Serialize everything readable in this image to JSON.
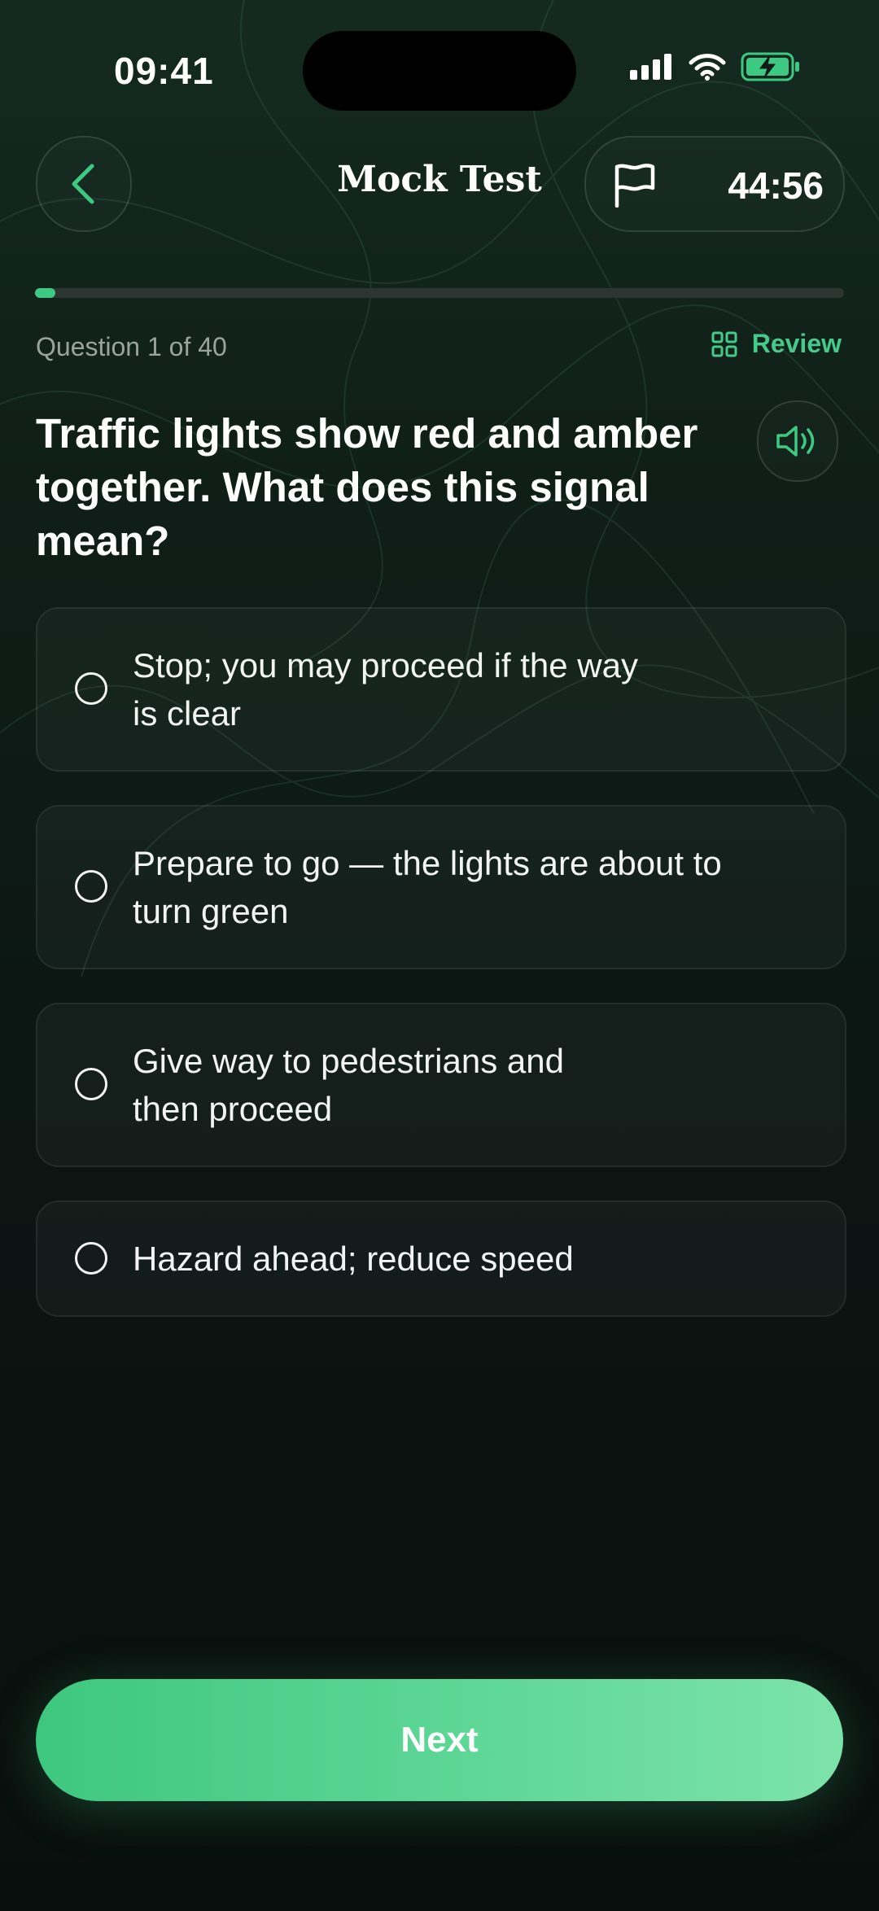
{
  "status_bar": {
    "time": "09:41"
  },
  "header": {
    "title": "Mock Test",
    "timer": "44:56"
  },
  "progress": {
    "current": 1,
    "total": 40,
    "fraction": 0.025,
    "label": "Question 1 of 40"
  },
  "review": {
    "label": "Review"
  },
  "question": {
    "text": "Traffic lights show red and amber together. What does this signal mean?"
  },
  "options": [
    {
      "line1": "Stop; you may proceed if the way",
      "line2": "is clear"
    },
    {
      "line1": "Prepare to go — the lights are about to",
      "line2": "turn green"
    },
    {
      "line1": "Give way to pedestrians and",
      "line2": "then proceed"
    },
    {
      "line1": "Hazard ahead; reduce speed",
      "line2": ""
    }
  ],
  "footer": {
    "next_label": "Next"
  },
  "colors": {
    "accent": "#3ec982",
    "background": "#0c1613"
  },
  "icons": [
    "chevron-left-icon",
    "flag-icon",
    "grid-icon",
    "speaker-icon",
    "signal-icon",
    "wifi-icon",
    "battery-charging-icon"
  ]
}
